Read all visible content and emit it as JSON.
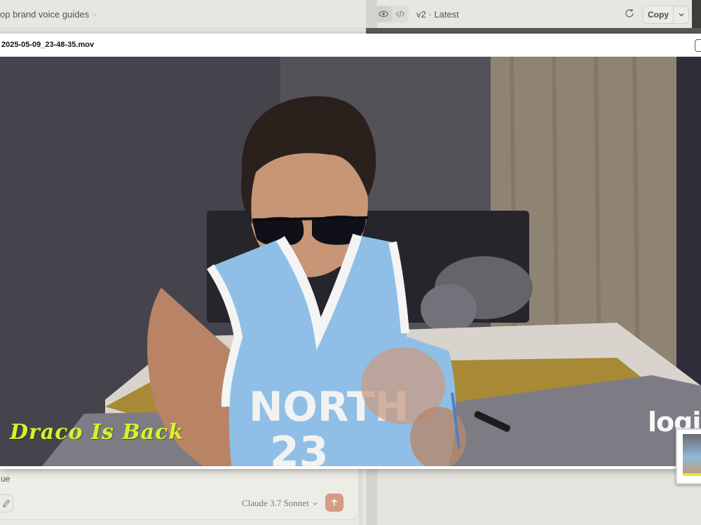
{
  "left_panel": {
    "project_title": "op brand voice guides",
    "composer_text": "ue",
    "model_name": "Claude 3.7 Sonnet"
  },
  "artifact_header": {
    "version_label": "v2 · Latest",
    "copy_label": "Copy"
  },
  "video_player": {
    "filename": "2025-05-09_23-48-35.mov",
    "overlay_caption": "Draco Is Back",
    "watermark_text": "logi",
    "jersey_text": "NORTH",
    "jersey_number": "23"
  },
  "icons": {
    "eye": "eye-icon",
    "code": "code-icon",
    "refresh": "refresh-icon",
    "chevron": "chevron-down-icon",
    "attach": "pen-icon",
    "send": "arrow-up-icon"
  },
  "colors": {
    "caption": "#d8f22c",
    "send_button": "#d59b83",
    "jersey": "#8fbfe6"
  }
}
